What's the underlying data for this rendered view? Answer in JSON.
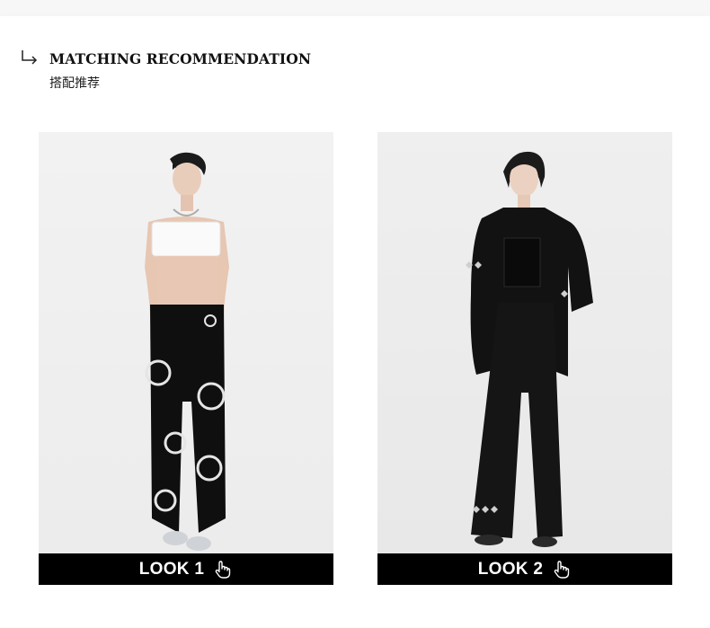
{
  "header": {
    "title": "MATCHING RECOMMENDATION",
    "subtitle": "搭配推荐",
    "icon": "arrow-turn-down-right-icon"
  },
  "looks": [
    {
      "label": "LOOK 1",
      "icon": "hand-pointer-icon"
    },
    {
      "label": "LOOK 2",
      "icon": "hand-pointer-icon"
    }
  ],
  "colors": {
    "bar": "#000000",
    "bar_text": "#ffffff",
    "page_bg": "#ffffff"
  }
}
